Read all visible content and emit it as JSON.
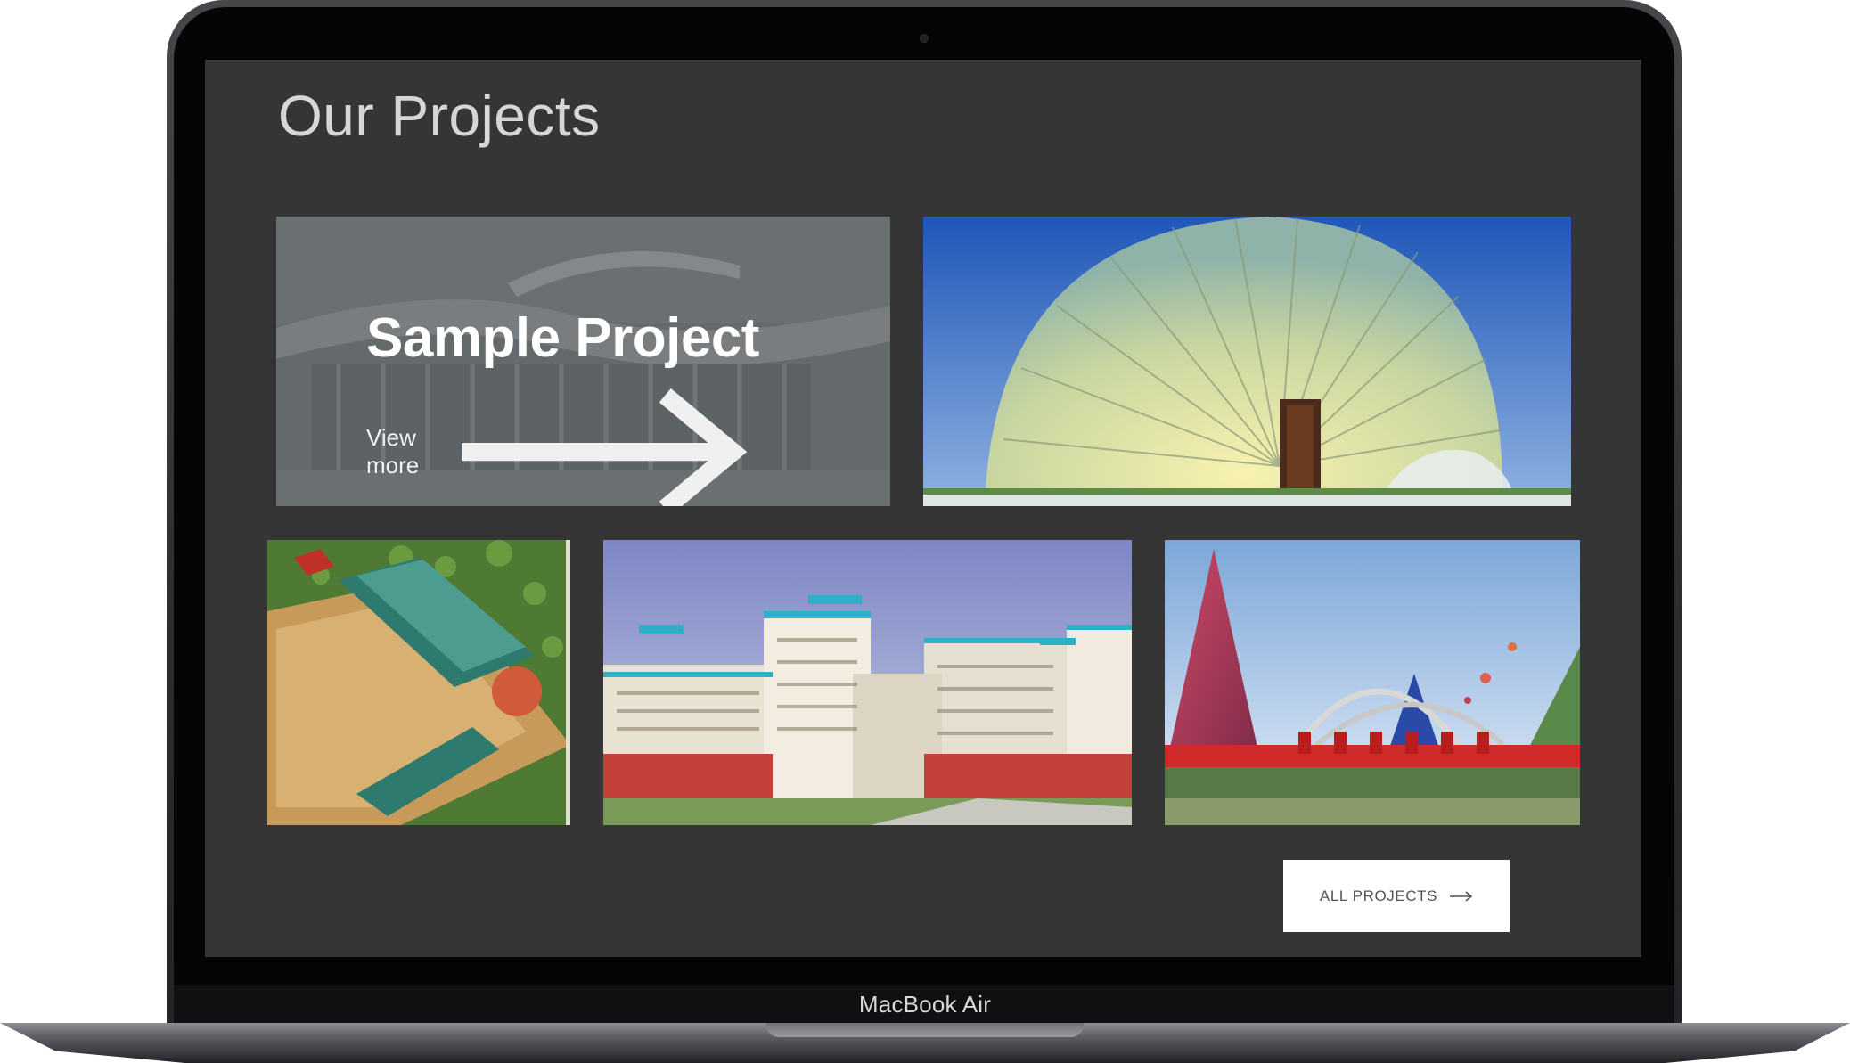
{
  "device": {
    "brand_label": "MacBook Air"
  },
  "section": {
    "title": "Our Projects"
  },
  "featured_project": {
    "title": "Sample Project",
    "link_label": "View more"
  },
  "projects": [
    {
      "image": "stadium-rendering"
    },
    {
      "image": "glass-dome-building"
    },
    {
      "image": "sports-complex-aerial"
    },
    {
      "image": "residential-towers"
    },
    {
      "image": "pyramid-arch-monument"
    }
  ],
  "actions": {
    "all_projects_label": "ALL PROJECTS"
  },
  "colors": {
    "screen_background": "#353535",
    "title_text": "#d6d6d6",
    "button_background": "#ffffff",
    "button_text": "#555555"
  },
  "icons": [
    "arrow-right-icon",
    "camera-icon"
  ]
}
